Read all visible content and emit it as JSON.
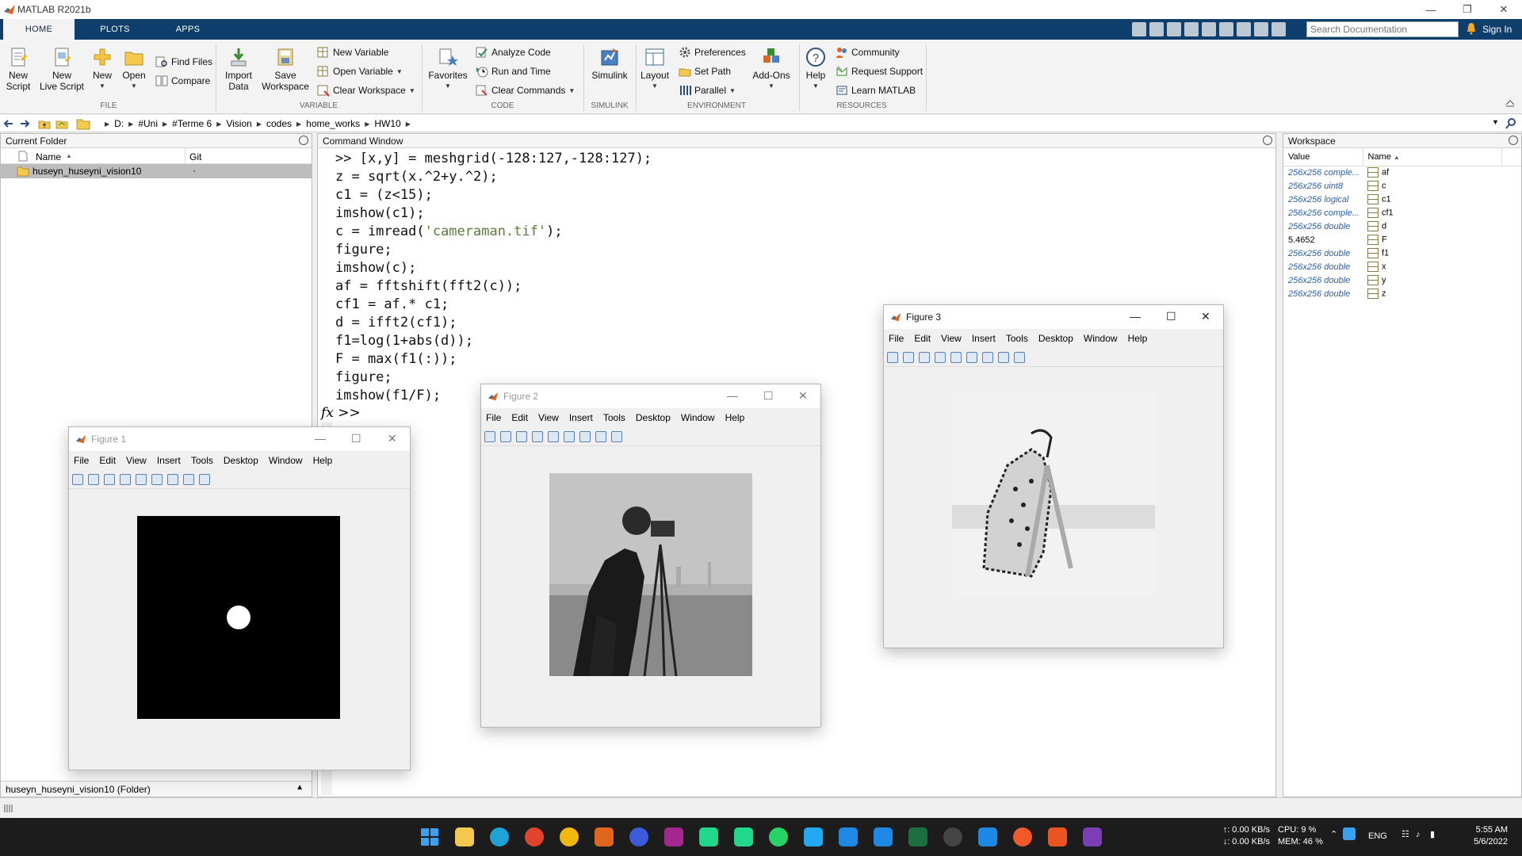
{
  "app": {
    "title": "MATLAB R2021b"
  },
  "tabs": [
    {
      "label": "HOME"
    },
    {
      "label": "PLOTS"
    },
    {
      "label": "APPS"
    }
  ],
  "search": {
    "placeholder": "Search Documentation"
  },
  "signin": "Sign In",
  "ribbon": {
    "file": {
      "new_script": "New\nScript",
      "new_live_script": "New\nLive Script",
      "new": "New",
      "open": "Open",
      "find_files": "Find Files",
      "compare": "Compare",
      "group": "FILE"
    },
    "variable": {
      "import_data": "Import\nData",
      "save_workspace": "Save\nWorkspace",
      "new_variable": "New Variable",
      "open_variable": "Open Variable",
      "clear_workspace": "Clear Workspace",
      "group": "VARIABLE"
    },
    "code": {
      "favorites": "Favorites",
      "analyze_code": "Analyze Code",
      "run_and_time": "Run and Time",
      "clear_commands": "Clear Commands",
      "group": "CODE"
    },
    "simulink": {
      "simulink": "Simulink",
      "group": "SIMULINK"
    },
    "environment": {
      "layout": "Layout",
      "preferences": "Preferences",
      "set_path": "Set Path",
      "parallel": "Parallel",
      "add_ons": "Add-Ons",
      "group": "ENVIRONMENT"
    },
    "resources": {
      "help": "Help",
      "community": "Community",
      "request_support": "Request Support",
      "learn_matlab": "Learn MATLAB",
      "group": "RESOURCES"
    }
  },
  "path": [
    "D:",
    "#Uni",
    "#Terme 6",
    "Vision",
    "codes",
    "home_works",
    "HW10"
  ],
  "current_folder": {
    "title": "Current Folder",
    "col_name": "Name",
    "col_git": "Git",
    "items": [
      {
        "name": "huseyn_huseyni_vision10",
        "git": "·"
      }
    ],
    "footer": "huseyn_huseyni_vision10  (Folder)"
  },
  "command_window": {
    "title": "Command Window",
    "lines": [
      ">> [x,y] = meshgrid(-128:127,-128:127);",
      "z = sqrt(x.^2+y.^2);",
      "c1 = (z<15);",
      "imshow(c1);",
      "c = imread(",
      "figure;",
      "imshow(c);",
      "af = fftshift(fft2(c));",
      "cf1 = af.* c1;",
      "d = ifft2(cf1);",
      "f1=log(1+abs(d));",
      "F = max(f1(:));",
      "figure;",
      "imshow(f1/F);"
    ],
    "string_literal": "'cameraman.tif'",
    "line5_tail": ");",
    "prompt": "fx >>"
  },
  "workspace": {
    "title": "Workspace",
    "col_value": "Value",
    "col_name": "Name",
    "vars": [
      {
        "value": "256x256 comple...",
        "name": "af"
      },
      {
        "value": "256x256 uint8",
        "name": "c"
      },
      {
        "value": "256x256 logical",
        "name": "c1"
      },
      {
        "value": "256x256 comple...",
        "name": "cf1"
      },
      {
        "value": "256x256 double",
        "name": "d"
      },
      {
        "value": "5.4652",
        "name": "F"
      },
      {
        "value": "256x256 double",
        "name": "f1"
      },
      {
        "value": "256x256 double",
        "name": "x"
      },
      {
        "value": "256x256 double",
        "name": "y"
      },
      {
        "value": "256x256 double",
        "name": "z"
      }
    ]
  },
  "figures": {
    "menu": [
      "File",
      "Edit",
      "View",
      "Insert",
      "Tools",
      "Desktop",
      "Window",
      "Help"
    ],
    "fig1": {
      "title": "Figure 1"
    },
    "fig2": {
      "title": "Figure 2"
    },
    "fig3": {
      "title": "Figure 3"
    }
  },
  "tray": {
    "net_up": "↑: 0.00 KB/s",
    "net_down": "↓: 0.00 KB/s",
    "cpu": "CPU: 9 %",
    "mem": "MEM: 46 %",
    "lang": "ENG",
    "time": "5:55 AM",
    "date": "5/6/2022"
  }
}
